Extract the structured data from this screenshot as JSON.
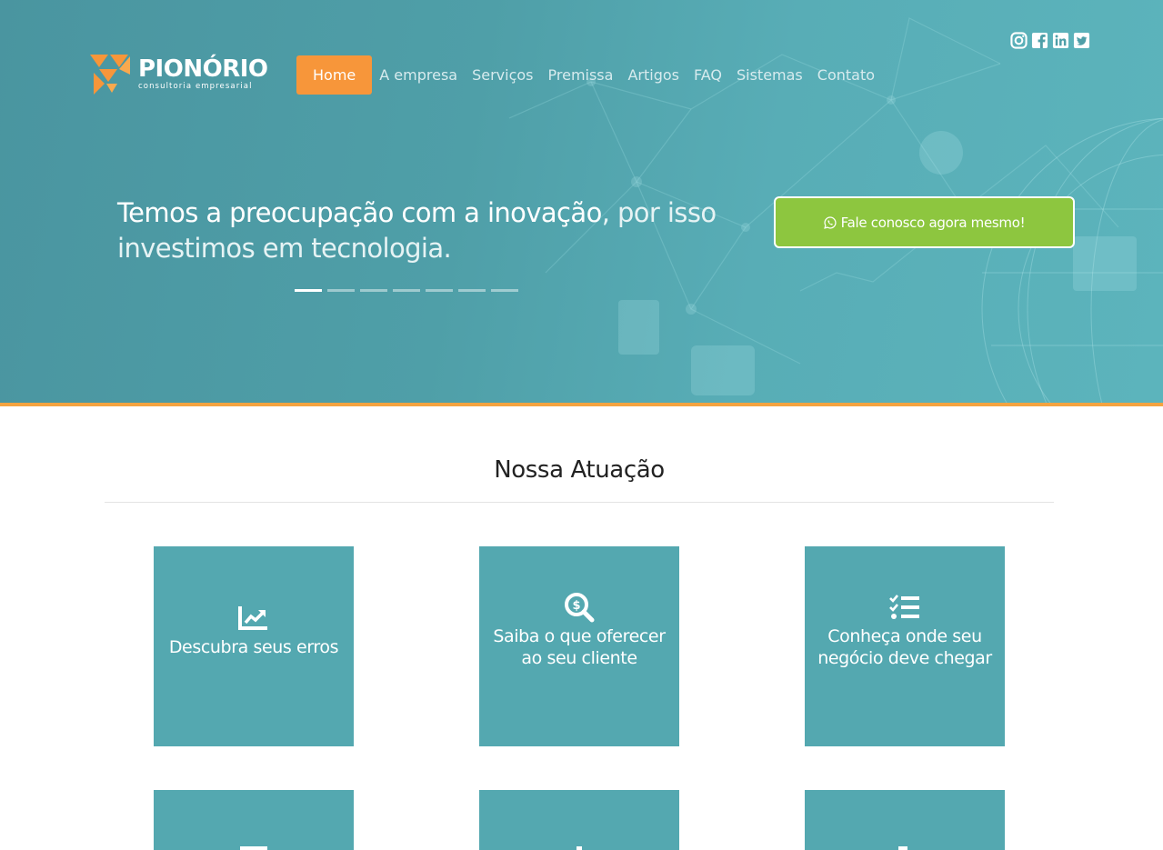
{
  "brand": {
    "name": "PIONÓRIO",
    "tagline": "consultoria empresarial"
  },
  "nav": {
    "items": [
      "Home",
      "A empresa",
      "Serviços",
      "Premissa",
      "Artigos",
      "FAQ",
      "Sistemas",
      "Contato"
    ],
    "active": "Home"
  },
  "social": [
    "instagram-icon",
    "facebook-icon",
    "linkedin-icon",
    "twitter-icon"
  ],
  "hero": {
    "headline_bold": "Temos a preocupação com a inovação",
    "headline_rest": ", por isso investimos em tecnologia.",
    "slides_total": 7,
    "slide_active": 1,
    "cta_label": "Fale conosco agora mesmo!"
  },
  "section": {
    "title": "Nossa Atuação"
  },
  "cards": [
    {
      "label": "Descubra seus erros",
      "icon": "chart-line-icon"
    },
    {
      "label": "Saiba o que oferecer ao seu cliente",
      "icon": "search-dollar-icon"
    },
    {
      "label": "Conheça onde seu negócio deve chegar",
      "icon": "tasks-icon"
    }
  ],
  "colors": {
    "hero": "#4f9fa8",
    "accent_orange": "#f7963a",
    "cta_green": "#8dc63f",
    "card_teal": "#54a8b0"
  }
}
